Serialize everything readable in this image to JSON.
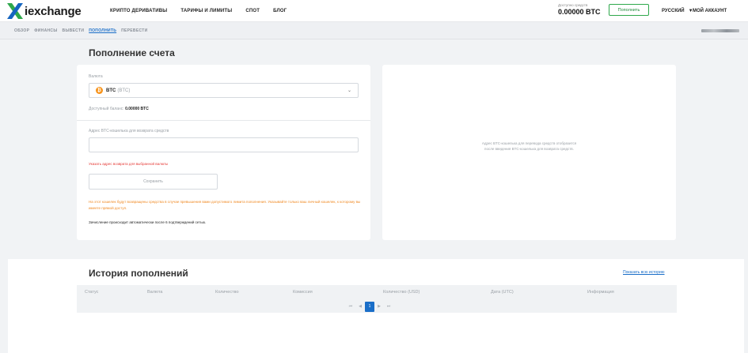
{
  "header": {
    "logo_text": "iexchange",
    "nav": [
      "КРИПТО ДЕРИВАТИВЫ",
      "ТАРИФЫ И ЛИМИТЫ",
      "СПОТ",
      "БЛОГ"
    ],
    "balance_label": "Доступно средств",
    "balance_value": "0.00000 BTC",
    "deposit_button": "Пополнить",
    "language": "РУССКИЙ",
    "account": "МОЙ АККАУНТ"
  },
  "subnav": {
    "tabs": [
      "ОБЗОР",
      "ФИНАНСЫ",
      "ВЫВЕСТИ",
      "ПОПОЛНИТЬ",
      "ПЕРЕВЕСТИ"
    ],
    "active": "ПОПОЛНИТЬ"
  },
  "deposit": {
    "title": "Пополнение счета",
    "currency_label": "Валюта",
    "currency_code": "BTC",
    "currency_sub": "(BTC)",
    "available_label": "Доступный баланс:",
    "available_value": "0.00000 BTC",
    "address_label": "Адрес BTC-кошелька для возврата средств",
    "address_value": "",
    "error": "Указать адрес возврата для выбранной валюты",
    "save_button": "Сохранить",
    "warning": "На этот кошелек будут возвращены средства в случае превышения вами допустимого лимита пополнения. Указывайте только ваш личный кошелек, к которому вы имеете прямой доступ.",
    "confirmations": "Зачисление происходит автоматически после 6 подтверждений сетью.",
    "right_info": "Адрес BTC-кошелька для перевода средств отобразится после введения BTC-кошелька для возврата средств."
  },
  "history": {
    "title": "История пополнений",
    "show_all": "Показать всю историю",
    "columns": [
      "Статус",
      "Валюта",
      "Количество",
      "Комиссия",
      "Количество (USD)",
      "Дата (UTC)",
      "Информация"
    ],
    "pagination": {
      "first": "⏮",
      "prev": "◀",
      "current": "1",
      "next": "▶",
      "last": "⏭"
    }
  },
  "colors": {
    "accent": "#1a6ec8",
    "brand_green": "#2ea84b",
    "btc": "#f7931a",
    "error": "#e53935",
    "warning": "#f08a24"
  }
}
